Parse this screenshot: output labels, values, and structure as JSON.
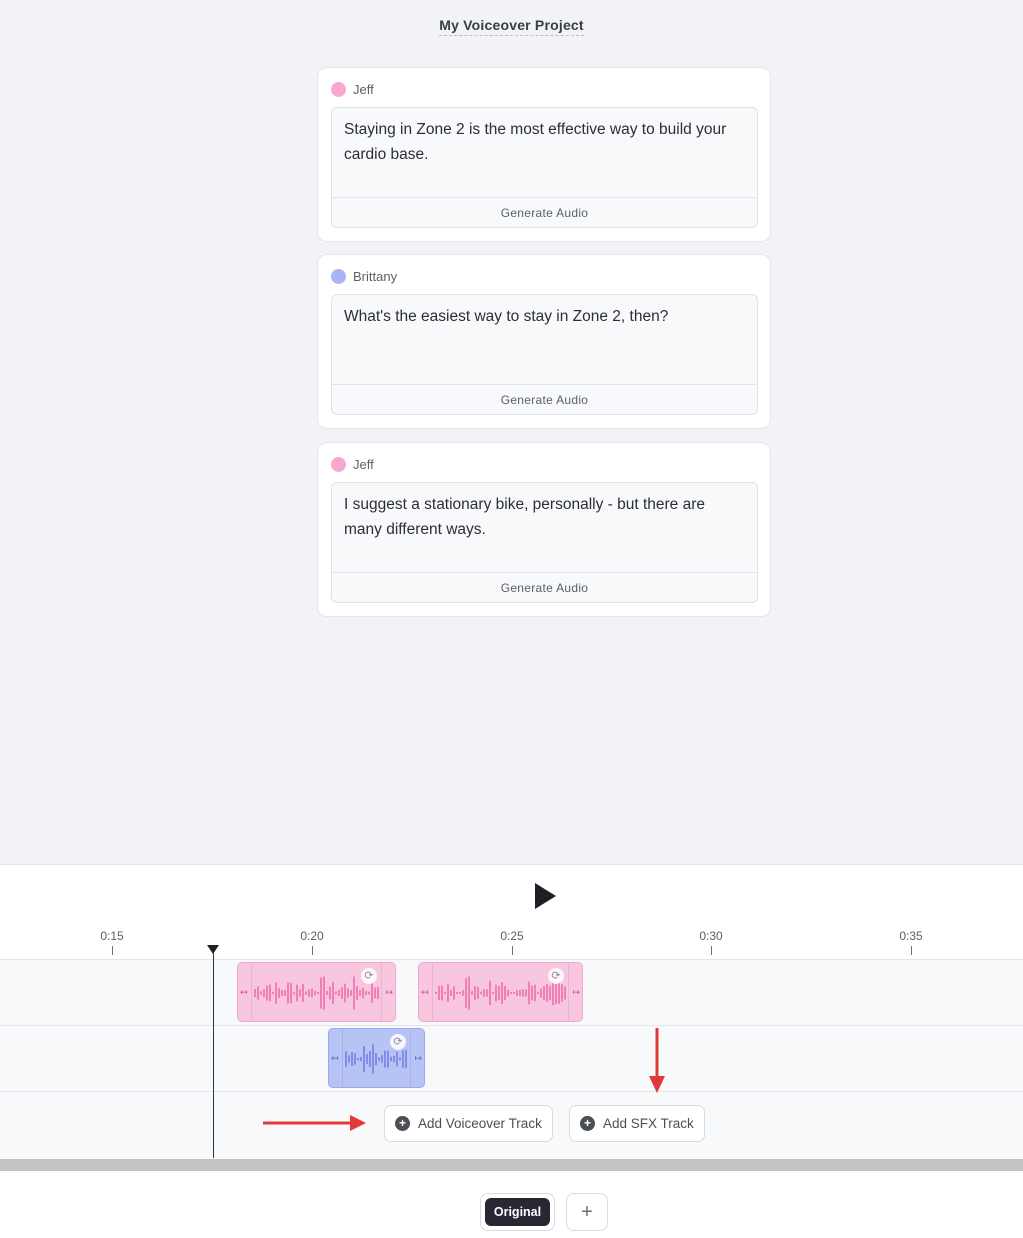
{
  "project": {
    "title": "My Voiceover Project"
  },
  "colors": {
    "jeff": "#f7a8cf",
    "brittany": "#a9b4f4",
    "annotation_arrow": "#e03a3a",
    "original_button": "#2a2733"
  },
  "dialogue": [
    {
      "speaker": "Jeff",
      "color": "#f7a8cf",
      "text": "Staying in Zone 2 is the most effective way to build your cardio base.",
      "action": "Generate Audio"
    },
    {
      "speaker": "Brittany",
      "color": "#a9b4f4",
      "text": "What's the easiest way to stay in Zone 2, then?",
      "action": "Generate Audio"
    },
    {
      "speaker": "Jeff",
      "color": "#f7a8cf",
      "text": "I suggest a stationary bike, personally - but there are many different ways.",
      "action": "Generate Audio"
    }
  ],
  "timeline": {
    "play_icon": "play-icon",
    "ticks": [
      "0:15",
      "0:20",
      "0:25",
      "0:30",
      "0:35"
    ],
    "add_voiceover_label": "Add Voiceover Track",
    "add_sfx_label": "Add SFX Track"
  },
  "versions": {
    "original_label": "Original",
    "add_icon": "+"
  }
}
